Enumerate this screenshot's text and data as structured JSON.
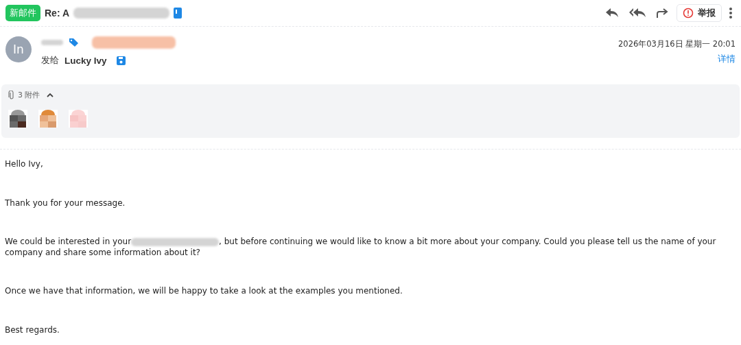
{
  "toolbar": {
    "badge": "新邮件",
    "subject": "Re: A",
    "report": "举报"
  },
  "header": {
    "avatar": "In",
    "to_label": "发给",
    "recipient": "Lucky Ivy",
    "date": "2026年03月16日 星期一 20:01",
    "details": "详情"
  },
  "attachments": {
    "count": "3 附件",
    "expanded": true
  },
  "body": [
    {
      "kind": "text",
      "text": "Hello Ivy,"
    },
    {
      "kind": "text",
      "text": "Thank you for your message."
    },
    {
      "kind": "redacted",
      "before": "We could be interested in your",
      "after": ", but before continuing we would like to know a bit more about your company. Could you please tell us the name of your company and share some information about it?"
    },
    {
      "kind": "text",
      "text": "Once we have that information, we will be happy to take a look at the examples you mentioned."
    },
    {
      "kind": "text",
      "text": "Best regards."
    }
  ]
}
